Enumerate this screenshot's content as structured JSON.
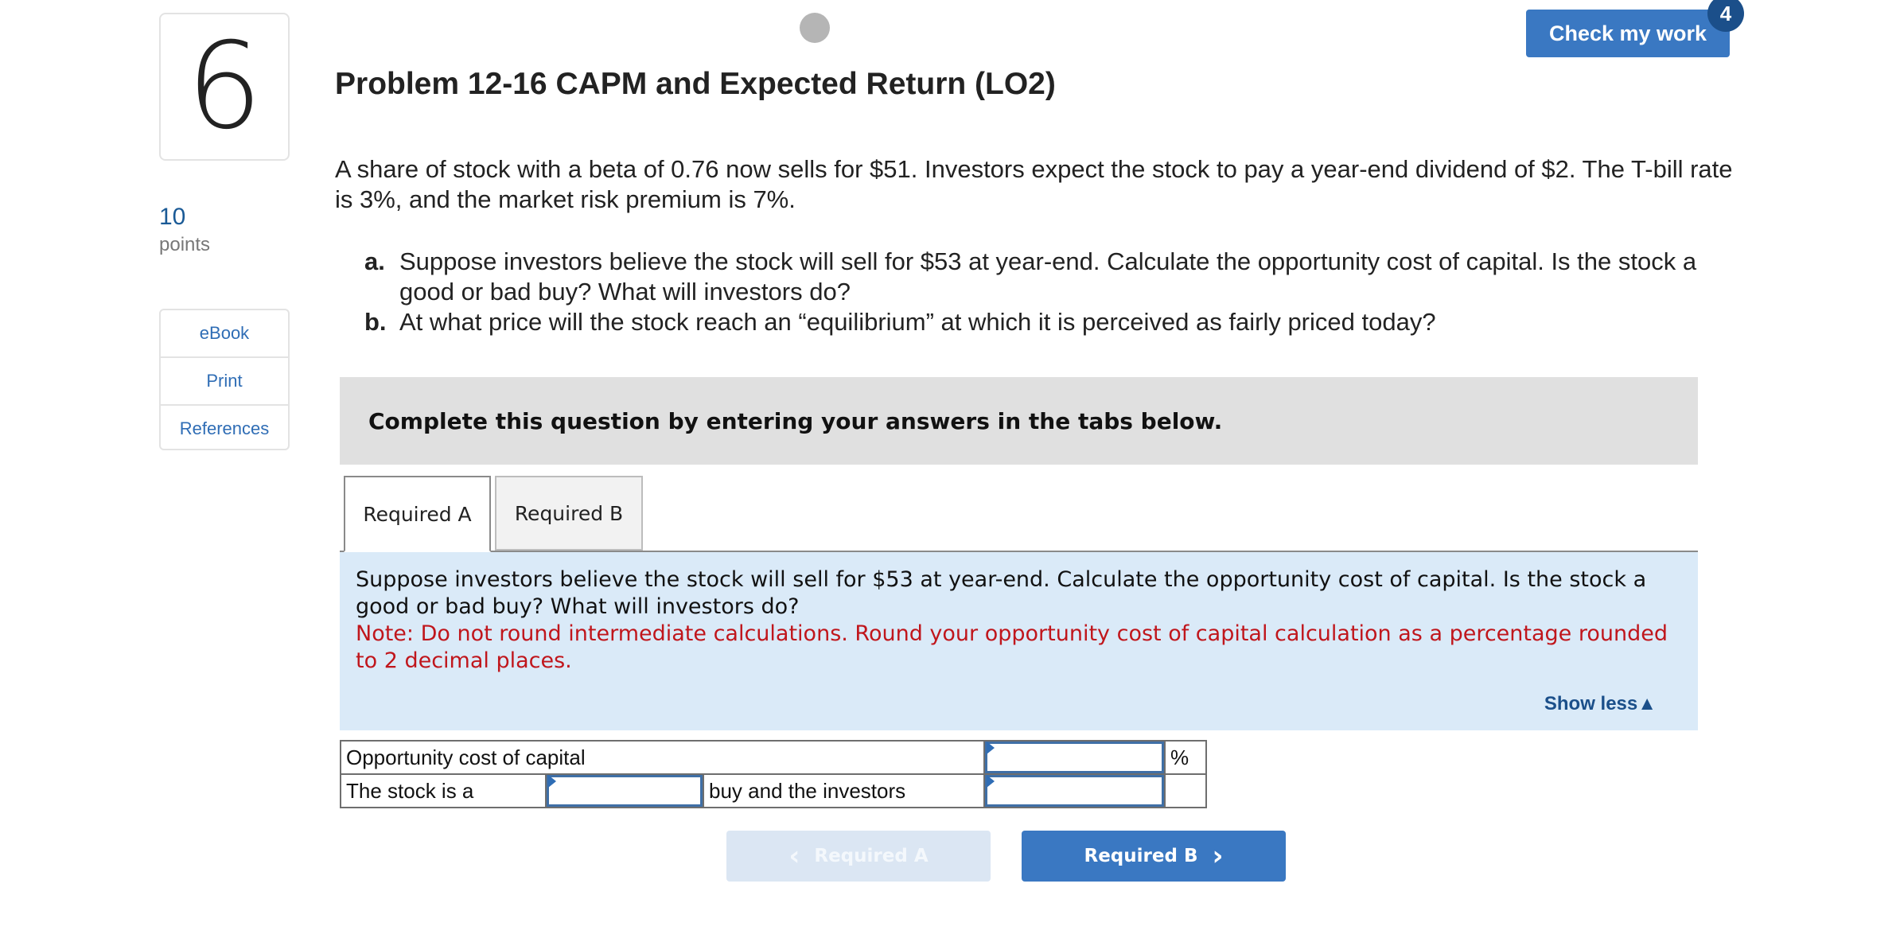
{
  "question": {
    "number": "6",
    "points_value": "10",
    "points_label": "points"
  },
  "side_links": [
    "eBook",
    "Print",
    "References"
  ],
  "header": {
    "check_button": "Check my work",
    "badge_count": "4"
  },
  "problem": {
    "title": "Problem 12-16 CAPM and Expected Return (LO2)",
    "intro": "A share of stock with a beta of 0.76 now sells for $51. Investors expect the stock to pay a year-end dividend of $2. The T-bill rate is 3%, and the market risk premium is 7%.",
    "parts": [
      {
        "letter": "a.",
        "text": "Suppose investors believe the stock will sell for $53 at year-end. Calculate the opportunity cost of capital. Is the stock a good or bad buy? What will investors do?"
      },
      {
        "letter": "b.",
        "text": "At what price will the stock reach an “equilibrium” at which it is perceived as fairly priced today?"
      }
    ]
  },
  "banner": "Complete this question by entering your answers in the tabs below.",
  "tabs": [
    "Required A",
    "Required B"
  ],
  "instructions": {
    "text": "Suppose investors believe the stock will sell for $53 at year-end. Calculate the opportunity cost of capital. Is the stock a good or bad buy? What will investors do?",
    "note": "Note: Do not round intermediate calculations. Round your opportunity cost of capital calculation as a percentage rounded to 2 decimal places.",
    "show_less": "Show less"
  },
  "answer_table": {
    "row1_label": "Opportunity cost of capital",
    "row1_unit": "%",
    "row2_label": "The stock is a",
    "row2_middle": "buy and the investors",
    "opportunity_cost_value": "",
    "stock_buy_value": "",
    "investor_action_value": ""
  },
  "nav": {
    "prev_label": "Required A",
    "next_label": "Required B"
  },
  "colors": {
    "accent": "#3a78c2",
    "note": "#c0161c",
    "instructions_bg": "#daeaf8"
  }
}
